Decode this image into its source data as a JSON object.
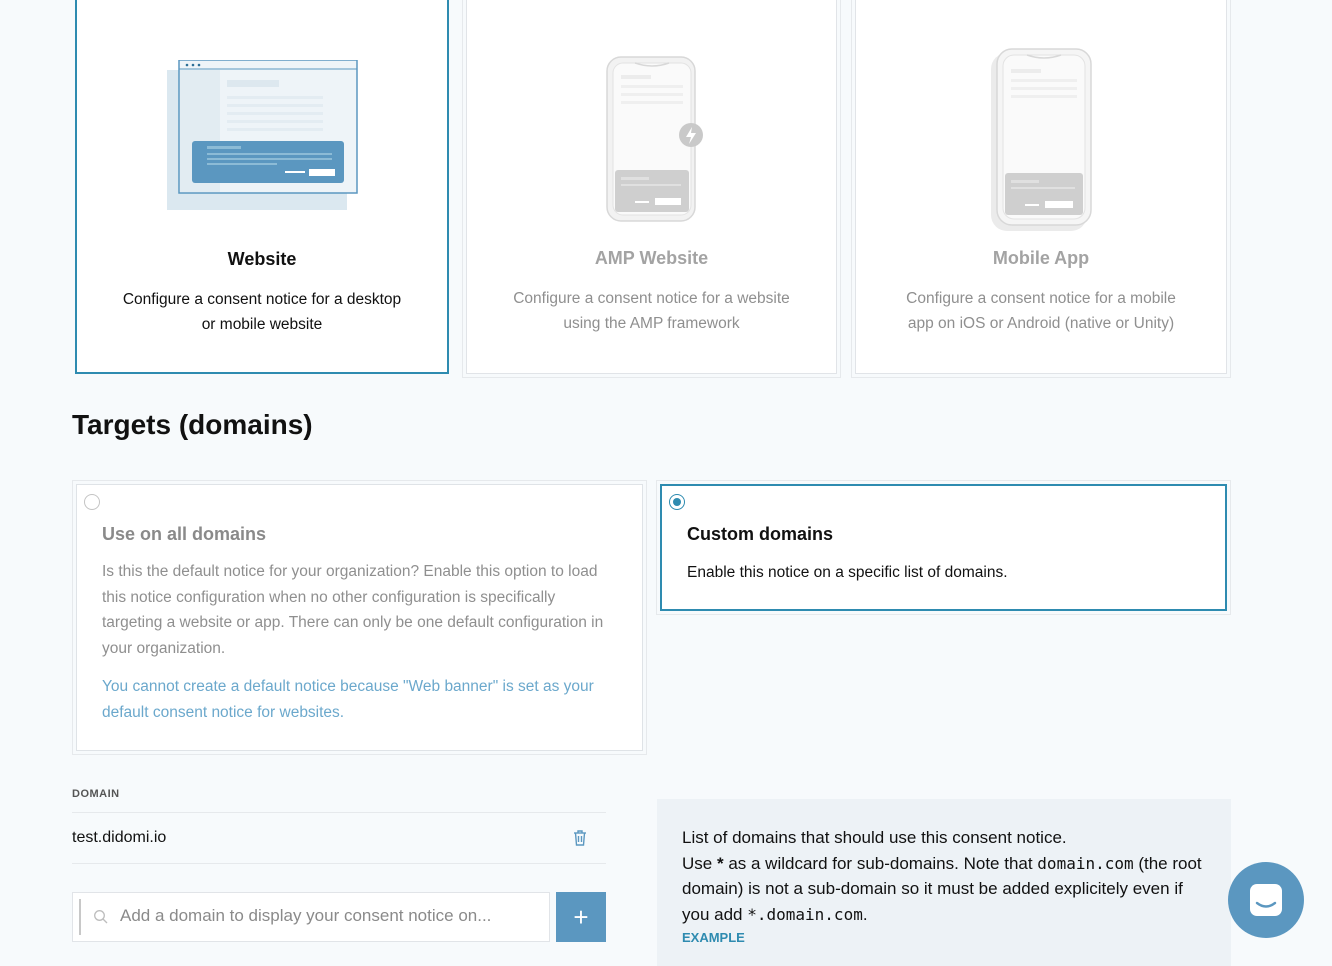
{
  "types": [
    {
      "title": "Website",
      "description": "Configure a consent notice for a desktop or mobile website",
      "selected": true
    },
    {
      "title": "AMP Website",
      "description": "Configure a consent notice for a website using the AMP framework",
      "selected": false
    },
    {
      "title": "Mobile App",
      "description": "Configure a consent notice for a mobile app on iOS or Android (native or Unity)",
      "selected": false
    }
  ],
  "targets": {
    "heading": "Targets (domains)",
    "all_domains": {
      "title": "Use on all domains",
      "description": "Is this the default notice for your organization? Enable this option to load this notice configuration when no other configuration is specifically targeting a website or app. There can only be one default configuration in your organization.",
      "warning": "You cannot create a default notice because \"Web banner\" is set as your default consent notice for websites.",
      "selected": false
    },
    "custom_domains": {
      "title": "Custom domains",
      "description": "Enable this notice on a specific list of domains.",
      "selected": true
    }
  },
  "domains": {
    "label": "DOMAIN",
    "items": [
      "test.didomi.io"
    ],
    "input_placeholder": "Add a domain to display your consent notice on...",
    "add_label": "+"
  },
  "help": {
    "line1": "List of domains that should use this consent notice.",
    "line2a": "Use ",
    "wildcard": "*",
    "line2b": " as a wildcard for sub-domains. Note that ",
    "domain_code": "domain.com",
    "line2c": " (the root domain) is not a sub-domain so it must be added explicitely even if you add ",
    "wildcard_domain_code": "*.domain.com",
    "line2d": ".",
    "example_label": "EXAMPLE"
  },
  "colors": {
    "accent": "#2e8bb0",
    "button": "#5b97c0",
    "warning_text": "#6ba8cc"
  },
  "icons": [
    "browser-illustration",
    "amp-phone-illustration",
    "mobile-phone-illustration",
    "search-icon",
    "trash-icon",
    "chat-icon"
  ]
}
